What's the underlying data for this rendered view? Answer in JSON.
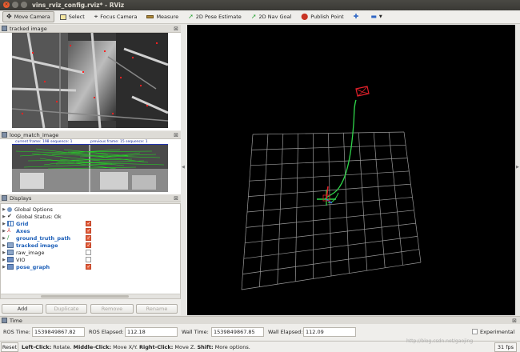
{
  "window": {
    "title": "vins_rviz_config.rviz* - RViz"
  },
  "toolbar": {
    "tools": [
      {
        "label": "Move Camera",
        "icon": "move-camera-icon",
        "active": true
      },
      {
        "label": "Select",
        "icon": "select-icon"
      },
      {
        "label": "Focus Camera",
        "icon": "focus-camera-icon"
      },
      {
        "label": "Measure",
        "icon": "measure-icon"
      },
      {
        "label": "2D Pose Estimate",
        "icon": "pose-estimate-icon"
      },
      {
        "label": "2D Nav Goal",
        "icon": "nav-goal-icon"
      },
      {
        "label": "Publish Point",
        "icon": "publish-point-icon"
      }
    ]
  },
  "panels": {
    "tracked_image_title": "tracked image",
    "loop_match_title": "loop_match_image",
    "loop_match_caption_left": "current frame: 198   sequence: 1",
    "loop_match_caption_right": "previous frame: 15   sequence: 1",
    "displays_title": "Displays"
  },
  "displays": {
    "items": [
      {
        "label": "Global Options",
        "icon": "gear-icon",
        "checked": null,
        "blue": false
      },
      {
        "label": "Global Status: Ok",
        "icon": "checkmark-icon",
        "checked": null,
        "blue": false
      },
      {
        "label": "Grid",
        "icon": "grid-icon",
        "checked": true,
        "blue": true
      },
      {
        "label": "Axes",
        "icon": "axes-icon",
        "checked": true,
        "blue": true
      },
      {
        "label": "ground_truth_path",
        "icon": "path-icon",
        "checked": true,
        "blue": true
      },
      {
        "label": "tracked image",
        "icon": "image-icon",
        "checked": true,
        "blue": true
      },
      {
        "label": "raw_image",
        "icon": "image-icon",
        "checked": false,
        "blue": false
      },
      {
        "label": "VIO",
        "icon": "folder-icon",
        "checked": false,
        "blue": false
      },
      {
        "label": "pose_graph",
        "icon": "folder-icon",
        "checked": true,
        "blue": true
      }
    ],
    "buttons": {
      "add": "Add",
      "duplicate": "Duplicate",
      "remove": "Remove",
      "rename": "Rename"
    }
  },
  "time": {
    "title": "Time",
    "ros_time_label": "ROS Time:",
    "ros_time": "1539849867.82",
    "ros_elapsed_label": "ROS Elapsed:",
    "ros_elapsed": "112.18",
    "wall_time_label": "Wall Time:",
    "wall_time": "1539849867.85",
    "wall_elapsed_label": "Wall Elapsed:",
    "wall_elapsed": "112.09",
    "experimental_label": "Experimental"
  },
  "status": {
    "reset_label": "Reset",
    "left_click": "Left-Click:",
    "left_click_action": " Rotate. ",
    "middle_click": "Middle-Click:",
    "middle_click_action": " Move X/Y. ",
    "right_click": "Right-Click:",
    "right_click_action": " Move Z. ",
    "shift": "Shift:",
    "shift_action": " More options.",
    "watermark": "http://blog.csdn.net/gaojing",
    "fps": "31 fps"
  },
  "colors": {
    "trajectory": "#2fd54a",
    "camera_frustum": "#e0202a",
    "grid": "#9a9a9a"
  }
}
